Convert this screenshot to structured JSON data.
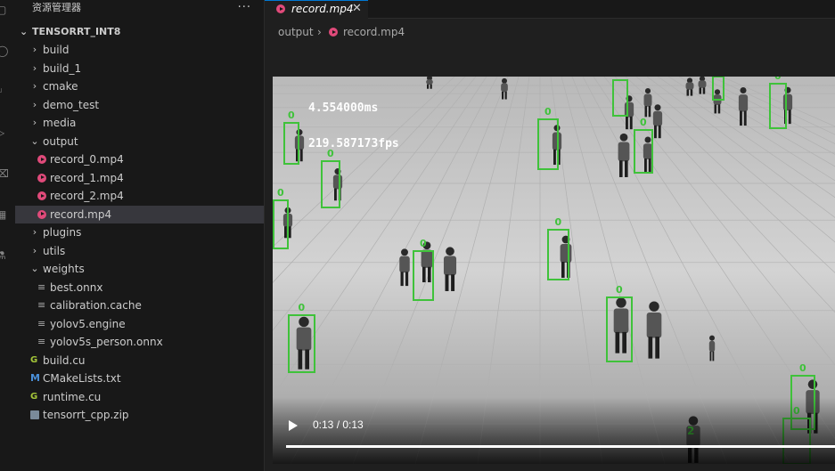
{
  "explorer": {
    "title": "资源管理器",
    "more": "···",
    "root": "TENSORRT_INT8",
    "items": [
      {
        "label": "build",
        "kind": "folder",
        "open": false,
        "depth": 1
      },
      {
        "label": "build_1",
        "kind": "folder",
        "open": false,
        "depth": 1
      },
      {
        "label": "cmake",
        "kind": "folder",
        "open": false,
        "depth": 1
      },
      {
        "label": "demo_test",
        "kind": "folder",
        "open": false,
        "depth": 1
      },
      {
        "label": "media",
        "kind": "folder",
        "open": false,
        "depth": 1
      },
      {
        "label": "output",
        "kind": "folder",
        "open": true,
        "depth": 1
      },
      {
        "label": "record_0.mp4",
        "kind": "video",
        "depth": 2
      },
      {
        "label": "record_1.mp4",
        "kind": "video",
        "depth": 2
      },
      {
        "label": "record_2.mp4",
        "kind": "video",
        "depth": 2
      },
      {
        "label": "record.mp4",
        "kind": "video",
        "depth": 2,
        "selected": true
      },
      {
        "label": "plugins",
        "kind": "folder",
        "open": false,
        "depth": 1
      },
      {
        "label": "utils",
        "kind": "folder",
        "open": false,
        "depth": 1
      },
      {
        "label": "weights",
        "kind": "folder",
        "open": true,
        "depth": 1
      },
      {
        "label": "best.onnx",
        "kind": "text",
        "depth": 2
      },
      {
        "label": "calibration.cache",
        "kind": "text",
        "depth": 2
      },
      {
        "label": "yolov5.engine",
        "kind": "text",
        "depth": 2
      },
      {
        "label": "yolov5s_person.onnx",
        "kind": "text",
        "depth": 2
      },
      {
        "label": "build.cu",
        "kind": "cu",
        "depth": 1
      },
      {
        "label": "CMakeLists.txt",
        "kind": "cmake",
        "depth": 1
      },
      {
        "label": "runtime.cu",
        "kind": "cu",
        "depth": 1
      },
      {
        "label": "tensorrt_cpp.zip",
        "kind": "zip",
        "depth": 1
      }
    ]
  },
  "editor": {
    "tab": {
      "label": "record.mp4",
      "close": "✕"
    },
    "breadcrumb": {
      "folder": "output",
      "separator": "›",
      "file": "record.mp4"
    }
  },
  "video": {
    "latency": "4.554000ms",
    "fps": "219.587173fps",
    "time": "0:13 / 0:13",
    "progress": 1.0,
    "detection_labels": [
      "0",
      "0",
      "0",
      "0",
      "0",
      "0",
      "0",
      "0",
      "0",
      "0",
      "0",
      "0",
      "0",
      "0",
      "2"
    ]
  },
  "colors": {
    "accent": "#0078d4",
    "box": "#3fc23a",
    "video_icon": "#e04a7a"
  }
}
